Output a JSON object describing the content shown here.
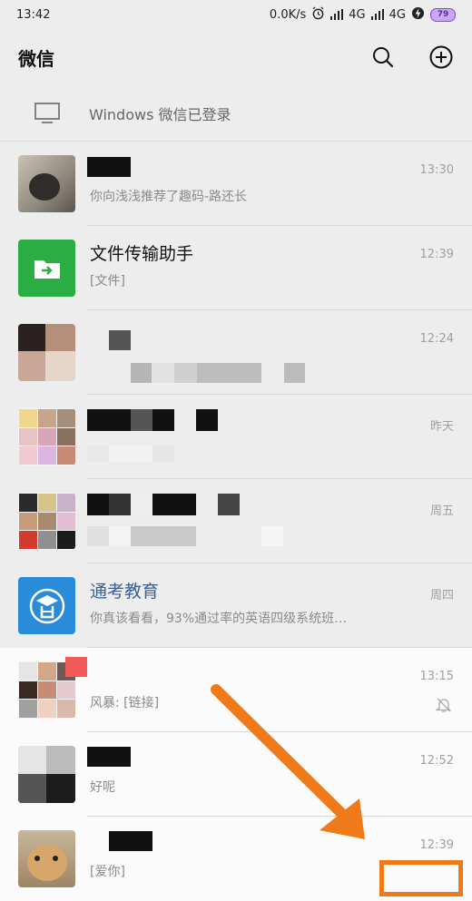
{
  "status_bar": {
    "time": "13:42",
    "speed": "0.0K/s",
    "network1": "4G",
    "network2": "4G",
    "battery": "79"
  },
  "header": {
    "title": "微信",
    "icons": [
      "search-icon",
      "add-circle-icon"
    ]
  },
  "pc_banner": {
    "text": "Windows 微信已登录",
    "icon": "monitor-icon"
  },
  "chats": [
    {
      "name": "",
      "preview": "你向浅浅推荐了趣码-路还长",
      "time": "13:30"
    },
    {
      "name": "文件传输助手",
      "preview": "[文件]",
      "time": "12:39"
    },
    {
      "name": "",
      "preview": "",
      "time": "12:24"
    },
    {
      "name": "",
      "preview": "",
      "time": "昨天"
    },
    {
      "name": "",
      "preview": "",
      "time": "周五"
    },
    {
      "name": "通考教育",
      "preview": "你真该看看，93%通过率的英语四级系统班…",
      "time": "周四"
    },
    {
      "name": "",
      "preview": "风暴: [链接]",
      "time": "13:15"
    },
    {
      "name": "",
      "preview": "好呢",
      "time": "12:52"
    },
    {
      "name": "",
      "preview": "[爱你]",
      "time": "12:39"
    }
  ],
  "colors": {
    "background": "#ededed",
    "file_helper_green": "#2aae43",
    "tongkao_blue": "#2a8bd8",
    "annotation_orange": "#f07a1a"
  }
}
